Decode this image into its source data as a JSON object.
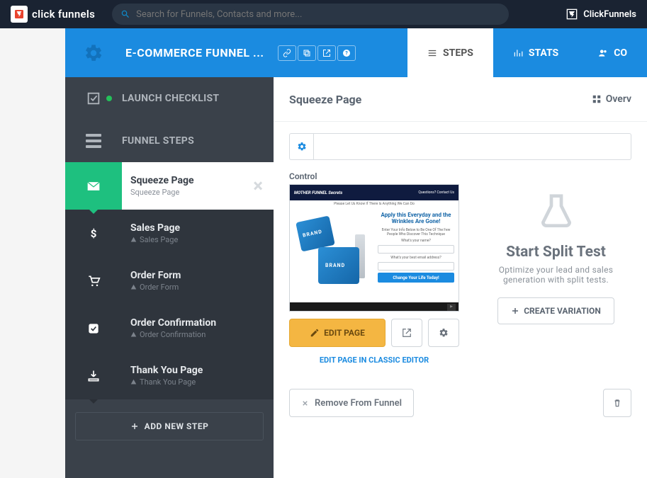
{
  "topbar": {
    "brand": "click funnels",
    "search_placeholder": "Search for Funnels, Contacts and more...",
    "right_label": "ClickFunnels"
  },
  "header": {
    "funnel_title": "E-COMMERCE FUNNEL ...",
    "tabs": {
      "steps": "STEPS",
      "stats": "STATS",
      "contacts": "CO"
    }
  },
  "sidebar": {
    "launch": "LAUNCH CHECKLIST",
    "funnel_steps": "FUNNEL STEPS",
    "steps": [
      {
        "title": "Squeeze Page",
        "sub": "Squeeze Page"
      },
      {
        "title": "Sales Page",
        "sub": "Sales Page"
      },
      {
        "title": "Order Form",
        "sub": "Order Form"
      },
      {
        "title": "Order Confirmation",
        "sub": "Order Confirmation"
      },
      {
        "title": "Thank You Page",
        "sub": "Thank You Page"
      }
    ],
    "add_step": "ADD NEW STEP"
  },
  "content": {
    "page_title": "Squeeze Page",
    "overview": "Overv",
    "control_label": "Control",
    "preview": {
      "banner_left": "MOTHER FUNNEL Secrets",
      "banner_right": "Questions? Contact Us",
      "sub": "Please Let Us Know If There Is Anything We Can Do",
      "headline": "Apply this Everyday and the Wrinkles Are Gone!",
      "subhead": "Enter Your Info Below to Be One Of The Few People Who Discover This Technique",
      "label1": "What's your name?",
      "label2": "What's your best email address?",
      "cta": "Change Your Life Today!",
      "brand": "BRAND"
    },
    "edit_page": "EDIT PAGE",
    "classic_link": "EDIT PAGE IN CLASSIC EDITOR",
    "split": {
      "title": "Start Split Test",
      "sub": "Optimize your lead and sales generation with split tests.",
      "create": "CREATE VARIATION"
    },
    "remove": "Remove From Funnel"
  }
}
